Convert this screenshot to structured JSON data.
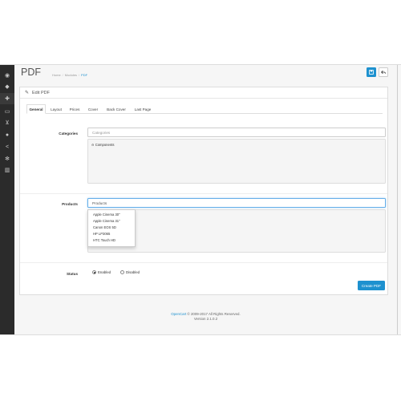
{
  "sidebar": {
    "items": [
      {
        "icon": "dashboard-icon",
        "glyph": "◉"
      },
      {
        "icon": "tags-icon",
        "glyph": "◆"
      },
      {
        "icon": "puzzle-icon",
        "glyph": "✚"
      },
      {
        "icon": "monitor-icon",
        "glyph": "▭"
      },
      {
        "icon": "cart-icon",
        "glyph": "⊻"
      },
      {
        "icon": "user-icon",
        "glyph": "●"
      },
      {
        "icon": "share-icon",
        "glyph": "<"
      },
      {
        "icon": "cog-icon",
        "glyph": "✻"
      },
      {
        "icon": "bar-chart-icon",
        "glyph": "▥"
      }
    ]
  },
  "header": {
    "title": "PDF",
    "breadcrumb": [
      "Home",
      "Modules",
      "PDF"
    ],
    "save_icon": "save-icon",
    "back_icon": "reply-icon"
  },
  "panel": {
    "title": "Edit PDF",
    "tabs": [
      "General",
      "Layout",
      "Prices",
      "Cover",
      "Back Cover",
      "Last Page"
    ],
    "active_tab": "General"
  },
  "form": {
    "categories": {
      "label": "Categories",
      "placeholder": "Categories",
      "selected": [
        "Components"
      ]
    },
    "products": {
      "label": "Products",
      "value": "Products",
      "suggestions": [
        "Apple Cinema 30\"",
        "Apple Cinema 31\"",
        "Canon EOS 5D",
        "HP LP3065",
        "HTC Touch HD"
      ]
    },
    "status": {
      "label": "Status",
      "options": [
        "Enabled",
        "Disabled"
      ],
      "selected": "Enabled"
    },
    "submit_label": "Create PDF"
  },
  "footer": {
    "brand": "OpenCart",
    "copyright": " © 2009-2017 All Rights Reserved.",
    "version": "Version 2.1.0.2"
  },
  "colors": {
    "accent": "#1e91cf",
    "sidebar": "#2b2b2b"
  }
}
